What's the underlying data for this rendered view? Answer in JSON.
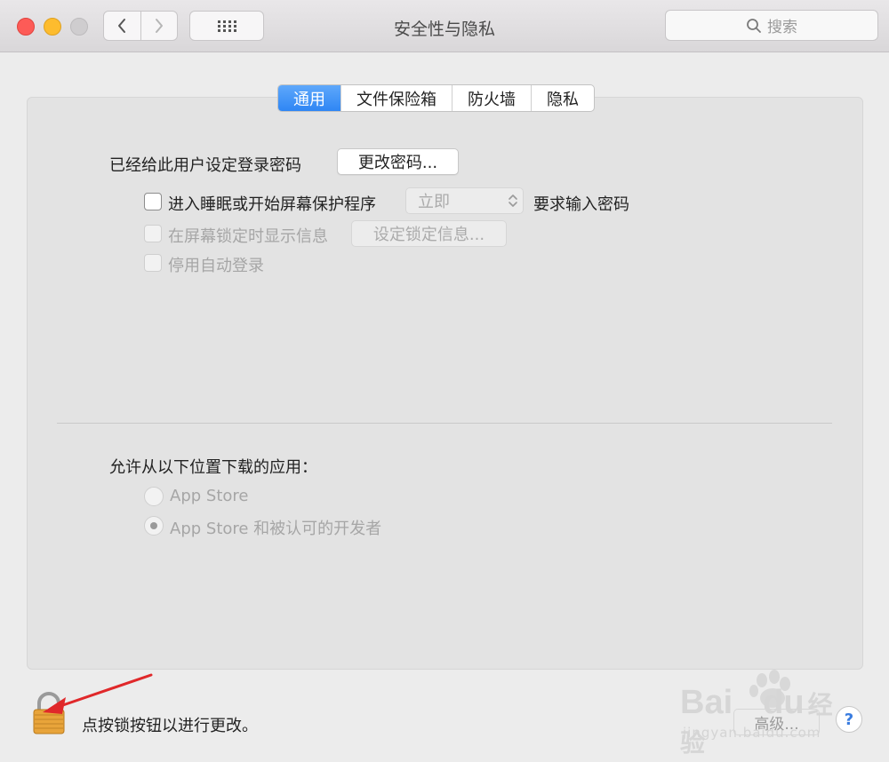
{
  "window": {
    "title": "安全性与隐私"
  },
  "toolbar": {
    "search_placeholder": "搜索"
  },
  "tabs": [
    {
      "label": "通用",
      "active": true
    },
    {
      "label": "文件保险箱",
      "active": false
    },
    {
      "label": "防火墙",
      "active": false
    },
    {
      "label": "隐私",
      "active": false
    }
  ],
  "general": {
    "password_label": "已经给此用户设定登录密码",
    "change_password_button": "更改密码...",
    "require_password": {
      "label": "进入睡眠或开始屏幕保护程序",
      "checked": false,
      "delay_value": "立即",
      "suffix": "要求输入密码"
    },
    "show_message": {
      "label": "在屏幕锁定时显示信息",
      "checked": false,
      "button": "设定锁定信息..."
    },
    "disable_auto_login": {
      "label": "停用自动登录",
      "checked": false
    }
  },
  "downloads": {
    "label": "允许从以下位置下载的应用：",
    "options": [
      {
        "label": "App Store",
        "selected": false
      },
      {
        "label": "App Store 和被认可的开发者",
        "selected": true
      }
    ]
  },
  "footer": {
    "lock_text": "点按锁按钮以进行更改。",
    "advanced_button": "高级...",
    "help": "?"
  },
  "watermark": {
    "brand": "Bai",
    "brand2": "du",
    "product": "经验",
    "url": "jingyan.baidu.com"
  },
  "colors": {
    "accent": "#2f86f4",
    "close": "#fd5b57",
    "minimize": "#fdbc2e",
    "arrow": "#e0282a",
    "lock": "#e8a43a"
  }
}
